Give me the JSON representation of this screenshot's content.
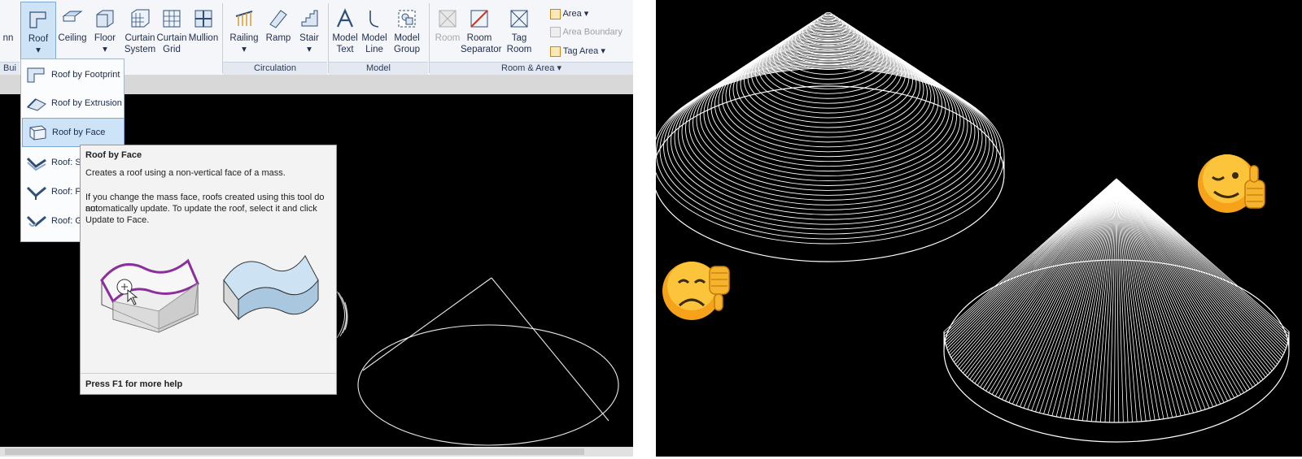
{
  "ribbon": {
    "partial_left": "nn",
    "buttons": {
      "roof": "Roof",
      "ceiling": "Ceiling",
      "floor": "Floor",
      "curtain_system": [
        "Curtain",
        "System"
      ],
      "curtain_grid": [
        "Curtain",
        "Grid"
      ],
      "mullion": "Mullion",
      "railing": "Railing",
      "ramp": "Ramp",
      "stair": "Stair",
      "model_text": [
        "Model",
        "Text"
      ],
      "model_line": [
        "Model",
        "Line"
      ],
      "model_group": [
        "Model",
        "Group"
      ],
      "room": "Room",
      "room_separator": [
        "Room",
        "Separator"
      ],
      "tag_room": [
        "Tag",
        "Room"
      ],
      "area": "Area",
      "area_boundary": "Area  Boundary",
      "tag_area": "Tag  Area"
    },
    "panels": {
      "build": "Bui",
      "circulation": "Circulation",
      "model": "Model",
      "room_area": "Room & Area ▾"
    }
  },
  "roof_menu": {
    "items": [
      "Roof by Footprint",
      "Roof by Extrusion",
      "Roof by Face",
      "Roof: Sc",
      "Roof: Fa",
      "Roof: Gu"
    ],
    "selected_index": 2
  },
  "tooltip": {
    "title": "Roof by Face",
    "line1": "Creates a roof using a non-vertical face of a mass.",
    "p2_line1": "If you change the mass face, roofs created using this tool do not",
    "p2_line2": "automatically update. To update the roof, select it and click",
    "p2_line3": "Update to Face.",
    "footer": "Press F1 for more help"
  },
  "colors": {
    "ribbon_bg": "#f4f6f9",
    "selection": "#cde4f8",
    "mass_outline": "#8a2f9c",
    "viewport_bg": "#000000"
  },
  "icons": {
    "thumbs_down": "sad-thumbs-down-emoji",
    "thumbs_up": "winking-thumbs-up-emoji"
  }
}
